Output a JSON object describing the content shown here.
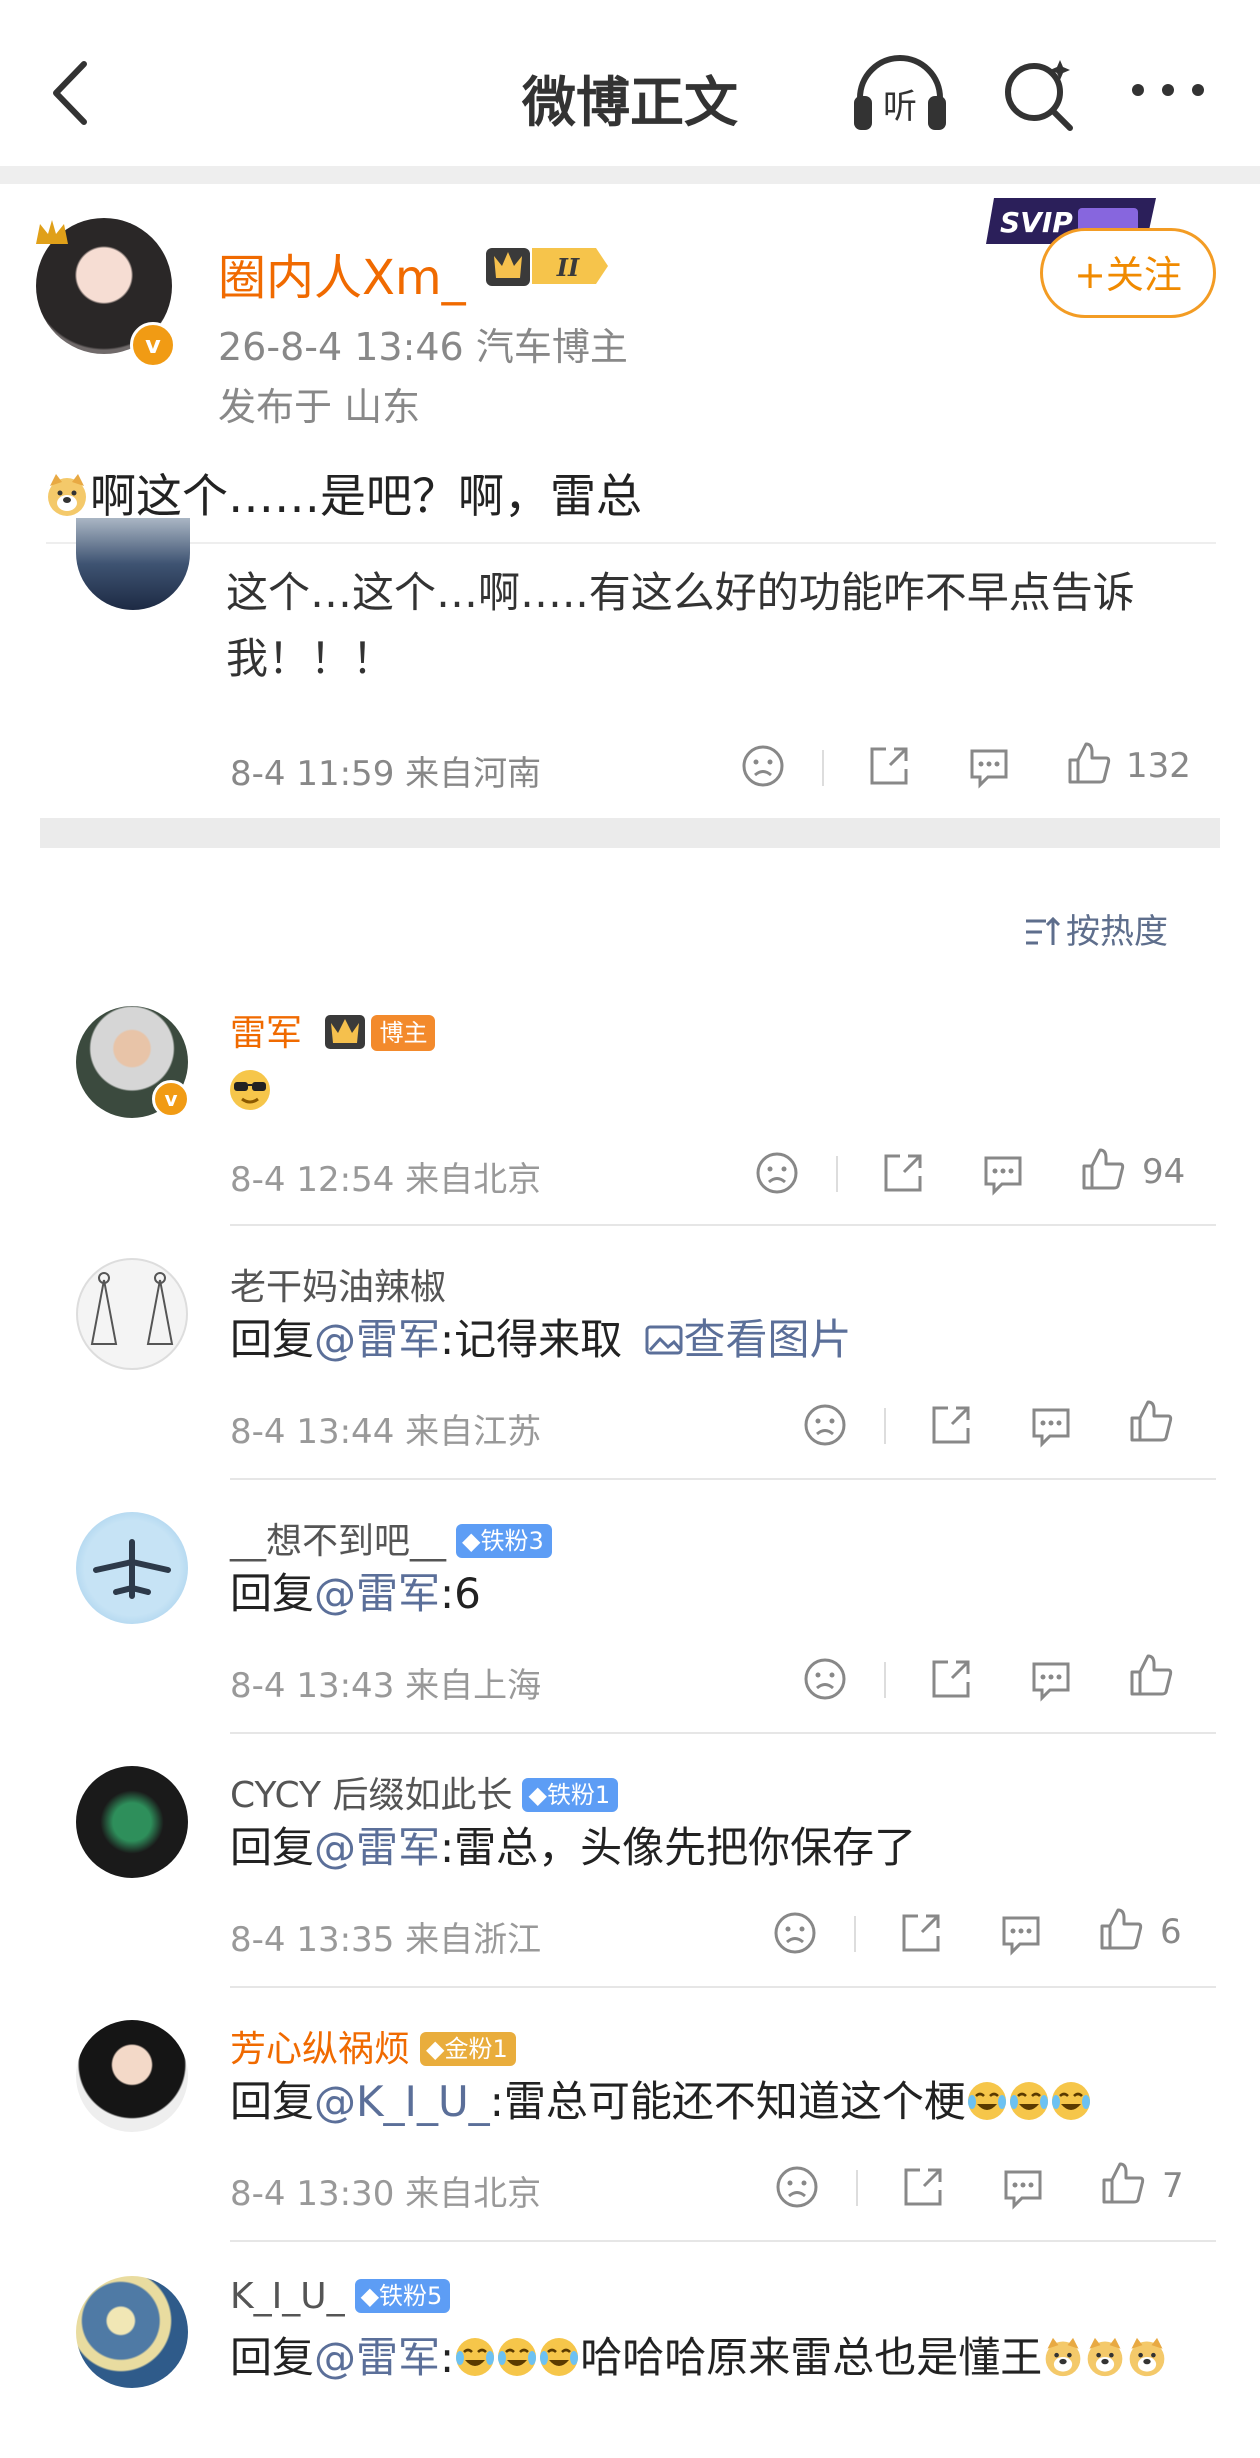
{
  "nav": {
    "title": "微博正文",
    "listen_label": "听"
  },
  "post": {
    "author": "圈内人Xm_",
    "level_badge": "II",
    "svip_tag": "SVIP",
    "date": "26-8-4 13:46",
    "source": "汽车博主",
    "location": "发布于 山东",
    "follow_label": "+关注",
    "text": "啊这个……是吧？啊，雷总",
    "quoted": {
      "text": "这个…这个…啊…..有这么好的功能咋不早点告诉我！！！",
      "time_loc": "8-4 11:59 来自河南",
      "likes": "132"
    }
  },
  "sort_label": "按热度",
  "comments": [
    {
      "name": "雷军",
      "badge": "博主",
      "text": "",
      "time_loc": "8-4 12:54 来自北京",
      "likes": "94"
    },
    {
      "name": "老干妈油辣椒",
      "reply_prefix": "回复",
      "at": "@雷军",
      "text": ":记得来取",
      "img_link": "查看图片",
      "time_loc": "8-4 13:44 来自江苏",
      "likes": ""
    },
    {
      "name": "__想不到吧__",
      "badge": "铁粉3",
      "reply_prefix": "回复",
      "at": "@雷军",
      "text": ":6",
      "time_loc": "8-4 13:43 来自上海",
      "likes": ""
    },
    {
      "name": "CYCY 后缀如此长",
      "badge": "铁粉1",
      "reply_prefix": "回复",
      "at": "@雷军",
      "text": ":雷总，头像先把你保存了",
      "time_loc": "8-4 13:35 来自浙江",
      "likes": "6"
    },
    {
      "name": "芳心纵祸烦",
      "badge": "金粉1",
      "reply_prefix": "回复",
      "at": "@K_I_U_",
      "text": ":雷总可能还不知道这个梗",
      "time_loc": "8-4 13:30 来自北京",
      "likes": "7"
    },
    {
      "name": "K_I_U_",
      "badge": "铁粉5",
      "reply_prefix": "回复",
      "at": "@雷军",
      "text": ":",
      "text2": "哈哈哈原来雷总也是懂王",
      "time_loc": "",
      "likes": ""
    }
  ],
  "colors": {
    "accent_orange": "#f06a00",
    "link_blue": "#5b6f99",
    "fan_blue": "#5d9df5",
    "gold": "#e9ad3c"
  }
}
